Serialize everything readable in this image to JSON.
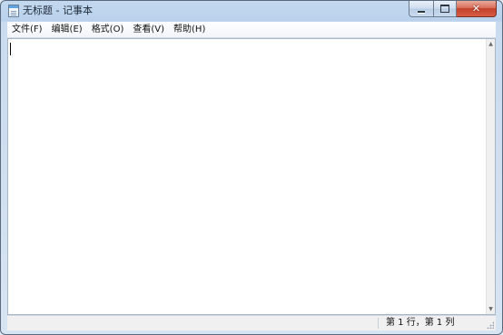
{
  "window": {
    "title": "无标题 - 记事本"
  },
  "title_controls": {
    "minimize_icon": "minimize-icon",
    "maximize_icon": "maximize-icon",
    "close_icon": "close-icon",
    "close_glyph": "✕"
  },
  "menu": {
    "items": [
      {
        "label": "文件(F)"
      },
      {
        "label": "编辑(E)"
      },
      {
        "label": "格式(O)"
      },
      {
        "label": "查看(V)"
      },
      {
        "label": "帮助(H)"
      }
    ]
  },
  "editor": {
    "content": ""
  },
  "statusbar": {
    "position": "第 1 行，第 1 列"
  },
  "colors": {
    "title_gradient_top": "#c4d9ef",
    "close_button": "#c4412a",
    "editor_bg": "#ffffff"
  }
}
